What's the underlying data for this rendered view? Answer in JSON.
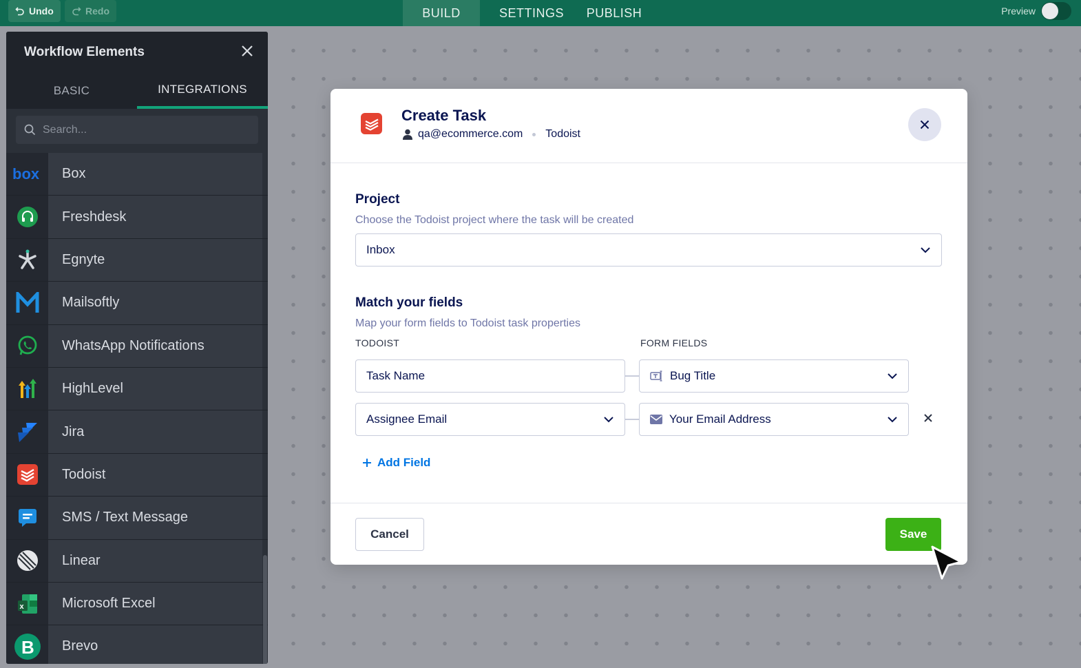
{
  "topbar": {
    "undo_label": "Undo",
    "redo_label": "Redo",
    "tabs": [
      {
        "label": "BUILD",
        "active": true
      },
      {
        "label": "SETTINGS",
        "active": false
      },
      {
        "label": "PUBLISH",
        "active": false
      }
    ],
    "preview_label": "Preview",
    "preview_on": false
  },
  "sidebar": {
    "title": "Workflow Elements",
    "tabs": [
      {
        "label": "BASIC",
        "active": false
      },
      {
        "label": "INTEGRATIONS",
        "active": true
      }
    ],
    "search_placeholder": "Search...",
    "items": [
      {
        "label": "Box",
        "icon": "box-icon"
      },
      {
        "label": "Freshdesk",
        "icon": "freshdesk-icon"
      },
      {
        "label": "Egnyte",
        "icon": "egnyte-icon"
      },
      {
        "label": "Mailsoftly",
        "icon": "mailsoftly-icon"
      },
      {
        "label": "WhatsApp Notifications",
        "icon": "whatsapp-icon"
      },
      {
        "label": "HighLevel",
        "icon": "highlevel-icon"
      },
      {
        "label": "Jira",
        "icon": "jira-icon"
      },
      {
        "label": "Todoist",
        "icon": "todoist-icon"
      },
      {
        "label": "SMS / Text Message",
        "icon": "sms-icon"
      },
      {
        "label": "Linear",
        "icon": "linear-icon"
      },
      {
        "label": "Microsoft Excel",
        "icon": "excel-icon"
      },
      {
        "label": "Brevo",
        "icon": "brevo-icon"
      }
    ]
  },
  "modal": {
    "title": "Create Task",
    "account": "qa@ecommerce.com",
    "service": "Todoist",
    "project": {
      "title": "Project",
      "description": "Choose the Todoist project where the task will be created",
      "selected": "Inbox"
    },
    "match": {
      "title": "Match your fields",
      "description": "Map your form fields to Todoist task properties",
      "col_left": "TODOIST",
      "col_right": "FORM FIELDS",
      "rows": [
        {
          "todoist": "Task Name",
          "form_field": "Bug Title"
        },
        {
          "todoist": "Assignee Email",
          "form_field": "Your Email Address"
        }
      ],
      "add_label": "Add Field"
    },
    "cancel_label": "Cancel",
    "save_label": "Save"
  },
  "colors": {
    "topbar": "#0f6b52",
    "accent_green": "#3cb116",
    "link_blue": "#0075e3",
    "heading_navy": "#0a1551",
    "todoist_red": "#e44332"
  }
}
